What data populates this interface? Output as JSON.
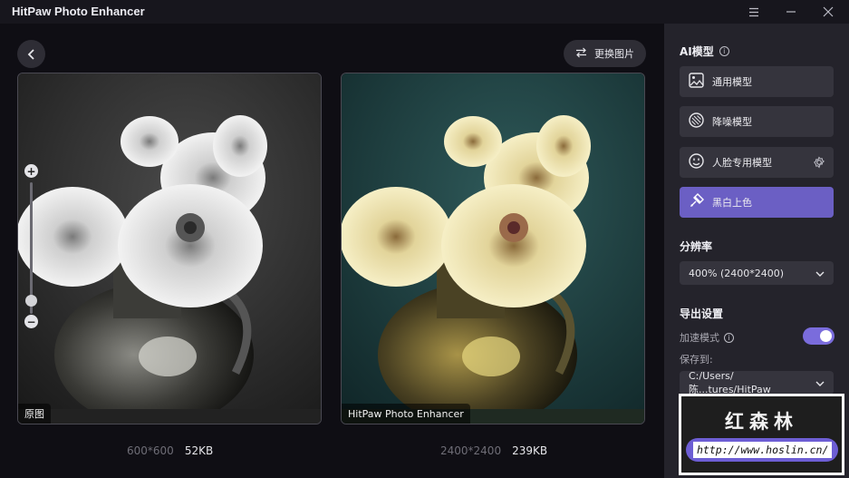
{
  "window": {
    "title": "HitPaw Photo Enhancer"
  },
  "toolbar": {
    "replace_label": "更换图片"
  },
  "original": {
    "label": "原图",
    "resolution": "600*600",
    "size": "52KB"
  },
  "enhanced": {
    "label": "HitPaw Photo Enhancer",
    "resolution": "2400*2400",
    "size": "239KB"
  },
  "zoom": {
    "level": 0.1
  },
  "sidebar": {
    "ai_model_title": "AI模型",
    "models": [
      {
        "label": "通用模型",
        "icon": "image-icon",
        "active": false
      },
      {
        "label": "降噪模型",
        "icon": "denoise-icon",
        "active": false
      },
      {
        "label": "人脸专用模型",
        "icon": "face-icon",
        "active": false
      },
      {
        "label": "黑白上色",
        "icon": "colorize-icon",
        "active": true
      }
    ],
    "resolution_title": "分辨率",
    "resolution_value": "400% (2400*2400)",
    "export_title": "导出设置",
    "accel_label": "加速模式",
    "accel_on": true,
    "save_to_label": "保存到:",
    "save_path": "C:/Users/陈...tures/HitPaw"
  },
  "watermark": {
    "title": "红森林",
    "url": "http://www.hoslin.cn/"
  },
  "colors": {
    "accent": "#6b5fc4",
    "toggle": "#7a6cdc",
    "sidebar_bg": "#24232b",
    "main_bg": "#0f0e14"
  }
}
